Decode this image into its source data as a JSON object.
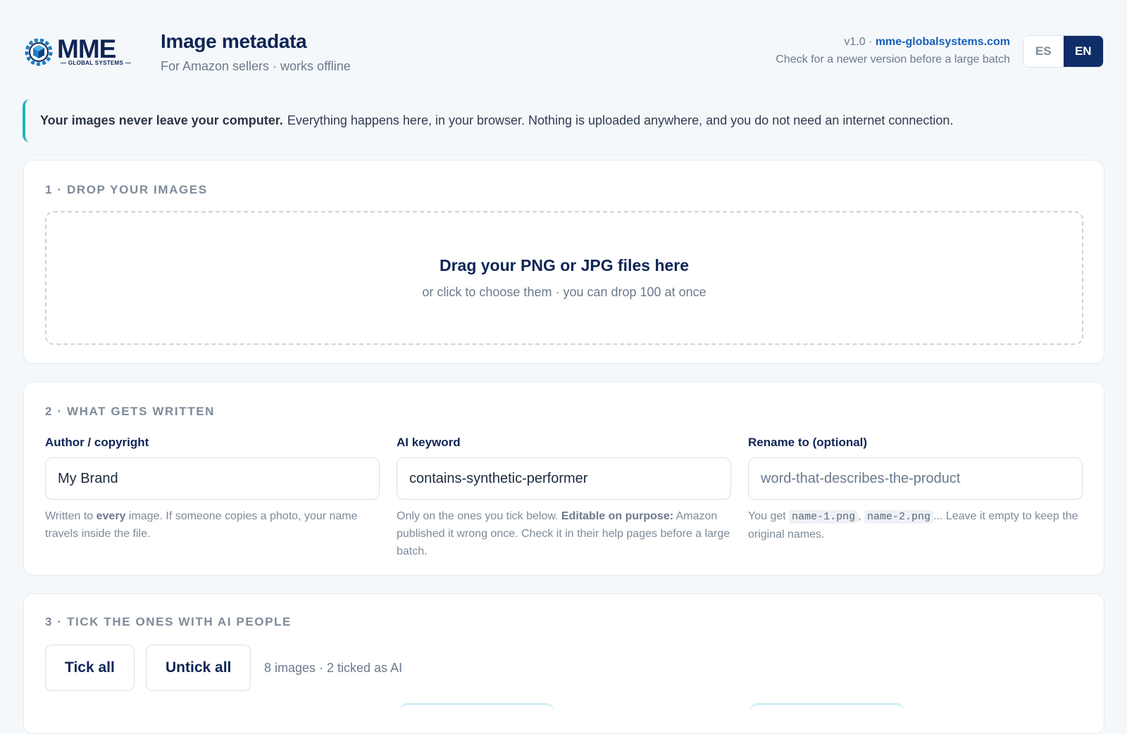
{
  "header": {
    "logo_text": "MME",
    "logo_tagline": "— GLOBAL SYSTEMS —",
    "title": "Image metadata",
    "subtitle": "For Amazon sellers · works offline",
    "version": "v1.0 · ",
    "site_link": "mme-globalsystems.com",
    "version_note": "Check for a newer version before a large batch",
    "languages": [
      {
        "code": "ES",
        "active": false
      },
      {
        "code": "EN",
        "active": true
      }
    ]
  },
  "notice": {
    "bold": "Your images never leave your computer.",
    "text": "Everything happens here, in your browser. Nothing is uploaded anywhere, and you do not need an internet connection."
  },
  "step1": {
    "title": "1 · DROP YOUR IMAGES",
    "drop_main": "Drag your PNG or JPG files here",
    "drop_sub": "or click to choose them · you can drop 100 at once"
  },
  "step2": {
    "title": "2 · WHAT GETS WRITTEN",
    "author": {
      "label": "Author / copyright",
      "value": "My Brand",
      "help_a": "Written to ",
      "help_b": "every",
      "help_c": " image. If someone copies a photo, your name travels inside the file."
    },
    "ai_keyword": {
      "label": "AI keyword",
      "value": "contains-synthetic-performer",
      "help_a": "Only on the ones you tick below. ",
      "help_b": "Editable on purpose:",
      "help_c": " Amazon published it wrong once. Check it in their help pages before a large batch."
    },
    "rename": {
      "label": "Rename to (optional)",
      "placeholder": "word-that-describes-the-product",
      "help_a": "You get ",
      "code1": "name-1.png",
      "sep": ", ",
      "code2": "name-2.png",
      "help_c": "... Leave it empty to keep the original names."
    }
  },
  "step3": {
    "title": "3 · TICK THE ONES WITH AI PEOPLE",
    "tick_all": "Tick all",
    "untick_all": "Untick all",
    "count": "8 images · 2 ticked as AI"
  },
  "colors": {
    "brand": "#0f2555",
    "accent": "#21b3c2",
    "link": "#1761b8"
  }
}
